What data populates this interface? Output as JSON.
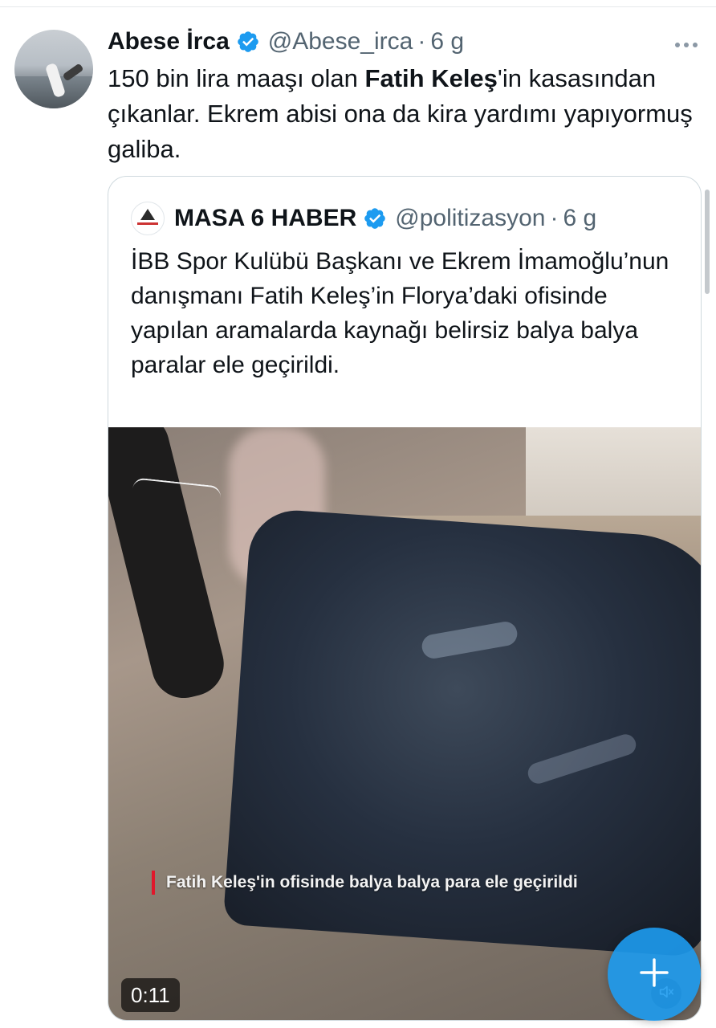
{
  "tweet": {
    "author_name": "Abese İrca",
    "author_handle": "@Abese_irca",
    "separator": "·",
    "time": "6 g",
    "text_part1": "150 bin lira maaşı olan ",
    "text_bold": "Fatih Keleş",
    "text_part2": "'in kasasından çıkanlar. Ekrem abisi ona da kira yardımı yapıyormuş galiba."
  },
  "quote": {
    "author_name": "MASA 6 HABER",
    "author_handle": "@politizasyon",
    "separator": "·",
    "time": "6 g",
    "text": "İBB Spor Kulübü Başkanı ve Ekrem İmamoğlu’nun danışmanı Fatih Keleş’in Florya’daki ofisinde yapılan aramalarda kaynağı belirsiz balya balya paralar ele geçirildi.",
    "video": {
      "caption": "Fatih Keleş'in ofisinde balya balya para ele geçirildi",
      "duration": "0:11"
    }
  },
  "colors": {
    "accent": "#1d9bf0",
    "caption_bar": "#e0182b",
    "text_primary": "#0f1419",
    "text_secondary": "#536471"
  },
  "icons": {
    "verified": "verified-badge-icon",
    "more": "more-icon",
    "mute": "mute-icon",
    "compose": "plus-icon"
  }
}
